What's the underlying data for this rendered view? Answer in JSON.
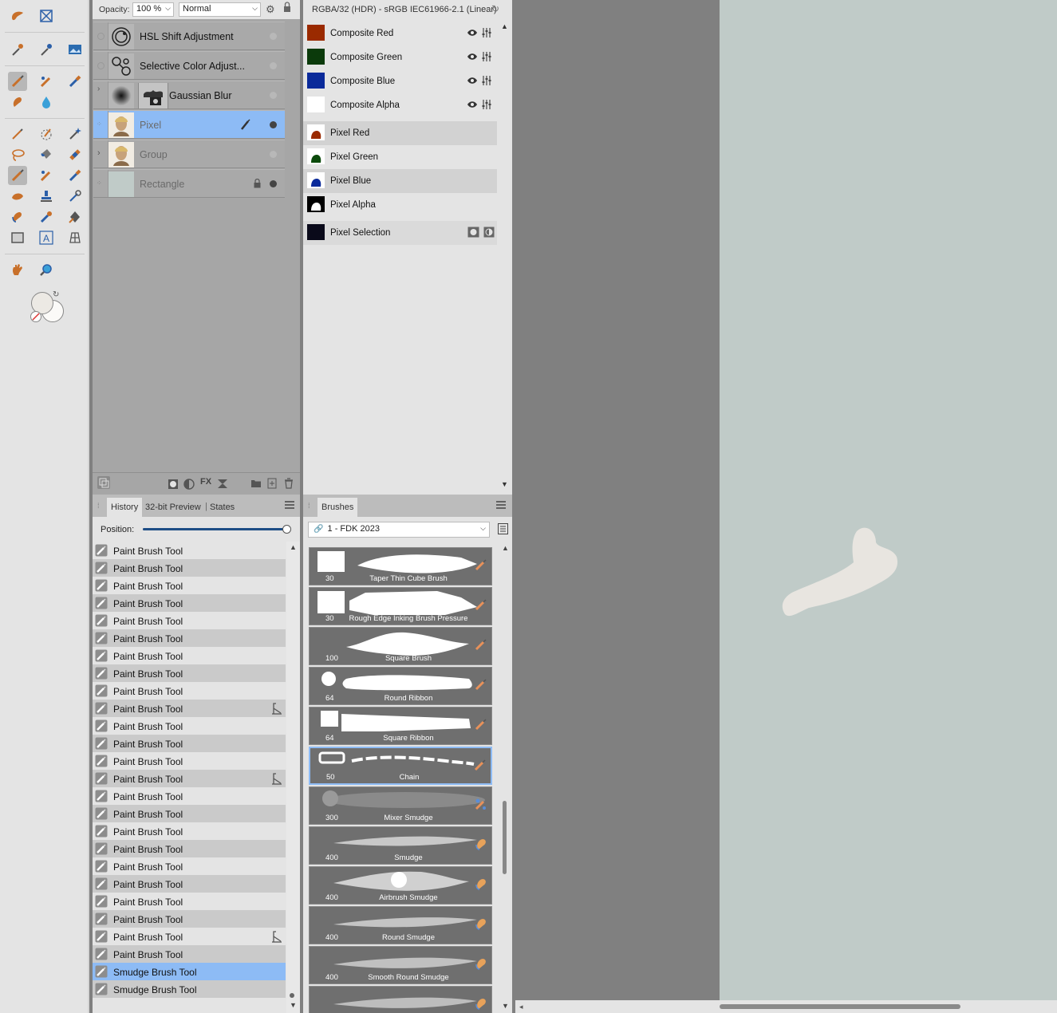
{
  "layers_panel": {
    "opacity_label": "Opacity:",
    "opacity_value": "100 %",
    "blend_mode": "Normal",
    "layers": [
      {
        "name": "HSL Shift Adjustment",
        "selected": false,
        "dim": false
      },
      {
        "name": "Selective Color Adjust...",
        "selected": false,
        "dim": false
      },
      {
        "name": "Gaussian Blur",
        "selected": false,
        "dim": false
      },
      {
        "name": "Pixel",
        "selected": true,
        "dim": true
      },
      {
        "name": "Group",
        "selected": false,
        "dim": true
      },
      {
        "name": "Rectangle",
        "selected": false,
        "dim": true
      }
    ]
  },
  "channels_panel": {
    "header": "RGBA/32 (HDR) - sRGB IEC61966-2.1 (Linear)",
    "composite": [
      {
        "name": "Composite Red",
        "color": "#9a2a00"
      },
      {
        "name": "Composite Green",
        "color": "#0b3a0b"
      },
      {
        "name": "Composite Blue",
        "color": "#0a2a9a"
      },
      {
        "name": "Composite Alpha",
        "color": "#ffffff"
      }
    ],
    "pixel": [
      {
        "name": "Pixel Red",
        "color": "#9a2a00"
      },
      {
        "name": "Pixel Green",
        "color": "#0b4a0b"
      },
      {
        "name": "Pixel Blue",
        "color": "#0a2a9a"
      },
      {
        "name": "Pixel Alpha",
        "color": "#ffffff"
      }
    ],
    "selection": {
      "name": "Pixel Selection",
      "color": "#0a0a1a"
    }
  },
  "history_panel": {
    "tabs": [
      "History",
      "32-bit Preview",
      "States"
    ],
    "position_label": "Position:",
    "position_value": 1.0,
    "items": [
      {
        "label": "Paint Brush Tool",
        "mark": false
      },
      {
        "label": "Paint Brush Tool",
        "mark": false
      },
      {
        "label": "Paint Brush Tool",
        "mark": false
      },
      {
        "label": "Paint Brush Tool",
        "mark": false
      },
      {
        "label": "Paint Brush Tool",
        "mark": false
      },
      {
        "label": "Paint Brush Tool",
        "mark": false
      },
      {
        "label": "Paint Brush Tool",
        "mark": false
      },
      {
        "label": "Paint Brush Tool",
        "mark": false
      },
      {
        "label": "Paint Brush Tool",
        "mark": false
      },
      {
        "label": "Paint Brush Tool",
        "mark": true
      },
      {
        "label": "Paint Brush Tool",
        "mark": false
      },
      {
        "label": "Paint Brush Tool",
        "mark": false
      },
      {
        "label": "Paint Brush Tool",
        "mark": false
      },
      {
        "label": "Paint Brush Tool",
        "mark": true
      },
      {
        "label": "Paint Brush Tool",
        "mark": false
      },
      {
        "label": "Paint Brush Tool",
        "mark": false
      },
      {
        "label": "Paint Brush Tool",
        "mark": false
      },
      {
        "label": "Paint Brush Tool",
        "mark": false
      },
      {
        "label": "Paint Brush Tool",
        "mark": false
      },
      {
        "label": "Paint Brush Tool",
        "mark": false
      },
      {
        "label": "Paint Brush Tool",
        "mark": false
      },
      {
        "label": "Paint Brush Tool",
        "mark": false
      },
      {
        "label": "Paint Brush Tool",
        "mark": true
      },
      {
        "label": "Paint Brush Tool",
        "mark": false
      },
      {
        "label": "Smudge Brush Tool",
        "mark": false,
        "selected": true
      },
      {
        "label": "Smudge Brush Tool",
        "mark": false
      }
    ]
  },
  "brushes_panel": {
    "tab": "Brushes",
    "category": "1 - FDK 2023",
    "brushes": [
      {
        "size": "30",
        "name": "Taper Thin Cube Brush",
        "icon": "paint-brush-icon"
      },
      {
        "size": "30",
        "name": "Rough Edge Inking Brush Pressure",
        "icon": "paint-brush-icon"
      },
      {
        "size": "100",
        "name": "Square Brush",
        "icon": "paint-brush-icon"
      },
      {
        "size": "64",
        "name": "Round Ribbon",
        "icon": "paint-brush-icon"
      },
      {
        "size": "64",
        "name": "Square Ribbon",
        "icon": "paint-brush-icon"
      },
      {
        "size": "50",
        "name": "Chain",
        "icon": "paint-brush-icon",
        "selected": true
      },
      {
        "size": "300",
        "name": "Mixer Smudge",
        "icon": "mixer-brush-icon"
      },
      {
        "size": "400",
        "name": "Smudge",
        "icon": "smudge-icon"
      },
      {
        "size": "400",
        "name": "Airbrush Smudge",
        "icon": "smudge-icon"
      },
      {
        "size": "400",
        "name": "Round Smudge",
        "icon": "smudge-icon"
      },
      {
        "size": "400",
        "name": "Smooth Round Smudge",
        "icon": "smudge-icon"
      }
    ]
  },
  "colors": {
    "panel_bg": "#e4e4e4",
    "selection_blue": "#8dbbf5",
    "canvas_doc": "#c0cbc8",
    "stroke": "#e8e5e0",
    "tool_orange": "#c8702a"
  }
}
